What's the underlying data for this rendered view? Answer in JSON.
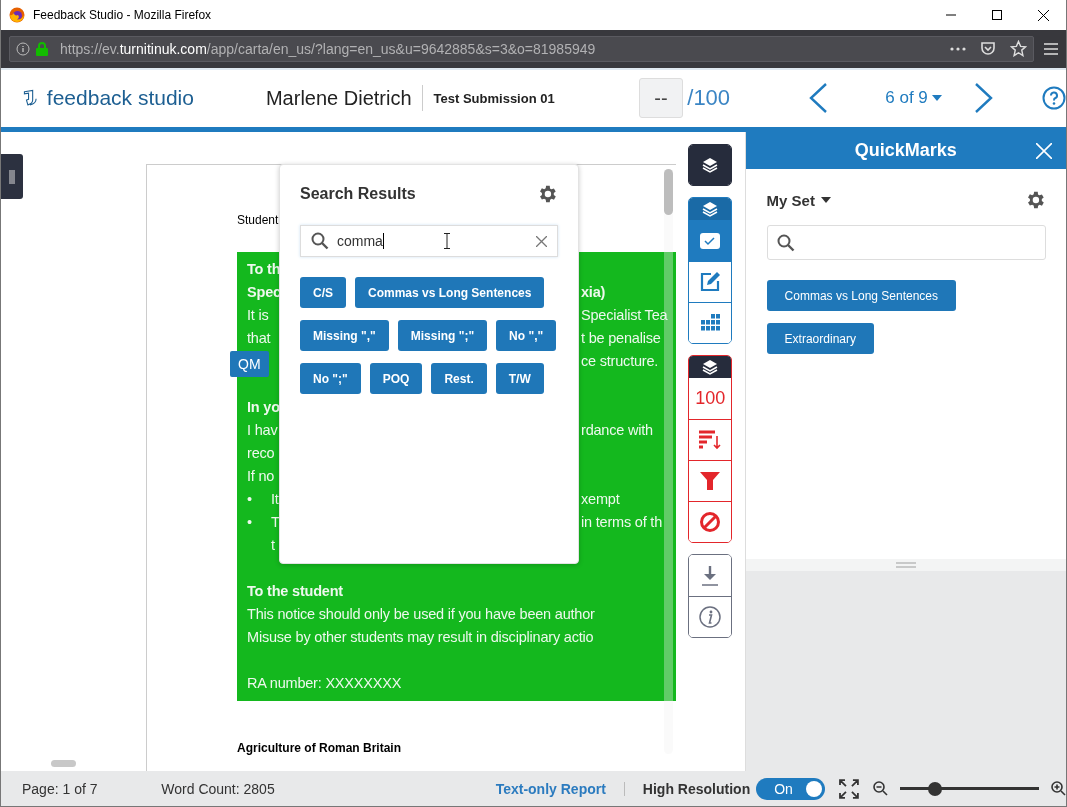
{
  "window": {
    "title": "Feedback Studio - Mozilla Firefox"
  },
  "browser": {
    "url": "https://ev.**turnitinuk.com**/app/carta/en_us/?lang=en_us&u=9642885&s=3&o=81985949"
  },
  "header": {
    "brand": "feedback studio",
    "student": "Marlene Dietrich",
    "assignment": "Test Submission 01",
    "score": "--",
    "score_max": "/100",
    "position": "6 of 9"
  },
  "document": {
    "student_label": "Student",
    "lines": [
      {
        "kind": "heading",
        "left": "To th"
      },
      {
        "kind": "heading",
        "left": "Spec",
        "right": "xia)"
      },
      {
        "kind": "text",
        "left": "It is",
        "right": "Specialist Tea"
      },
      {
        "kind": "text",
        "left": "that",
        "right": "t be penalise"
      },
      {
        "kind": "text",
        "right": "ce structure."
      },
      {
        "kind": "blank"
      },
      {
        "kind": "heading",
        "left": "In yo"
      },
      {
        "kind": "text",
        "left": "I hav",
        "right": "rdance with"
      },
      {
        "kind": "text",
        "left": "reco"
      },
      {
        "kind": "text",
        "left": "If no"
      },
      {
        "kind": "bullet",
        "bullet": "•",
        "left": "It",
        "right": "xempt"
      },
      {
        "kind": "bullet",
        "bullet": "•",
        "left": "T",
        "right": "in terms of th"
      },
      {
        "kind": "continuation",
        "left": "t"
      },
      {
        "kind": "blank"
      },
      {
        "kind": "heading",
        "left": "To the student"
      },
      {
        "kind": "text",
        "left": "This notice should only be used if you have been author"
      },
      {
        "kind": "text",
        "left": "Misuse by other students may result in disciplinary actio"
      },
      {
        "kind": "blank"
      },
      {
        "kind": "text",
        "left": "RA number: XXXXXXXX"
      }
    ],
    "title": "Agriculture of Roman Britain"
  },
  "qm_tag": "QM",
  "search_popup": {
    "title": "Search Results",
    "query": "comma",
    "results": [
      "C/S",
      "Commas vs Long Sentences",
      "Missing \",\"",
      "Missing \";\"",
      "No \",\"",
      "No \";\"",
      "POQ",
      "Rest.",
      "T/W"
    ]
  },
  "toolbar": {
    "groups": [
      {
        "color": "#262c3c",
        "buttons": [
          {
            "kind": "layers",
            "selected": true
          }
        ]
      },
      {
        "color": "#1f7bbf",
        "tab": {
          "color": "#1a6aa6"
        },
        "buttons": [
          {
            "kind": "check",
            "selected": true
          },
          {
            "kind": "edit",
            "selected": false
          },
          {
            "kind": "grid",
            "selected": false
          }
        ]
      },
      {
        "color": "#e3262b",
        "tab": {
          "color": "#262c3c"
        },
        "buttons": [
          {
            "kind": "score",
            "label": "100",
            "selected": false
          },
          {
            "kind": "sort",
            "selected": false
          },
          {
            "kind": "filter",
            "selected": false
          },
          {
            "kind": "ban",
            "selected": false
          }
        ]
      },
      {
        "color": "#6b7080",
        "buttons": [
          {
            "kind": "download",
            "selected": false
          },
          {
            "kind": "info",
            "selected": false
          }
        ]
      }
    ]
  },
  "quickmarks": {
    "title": "QuickMarks",
    "set": "My Set",
    "marks": [
      "Commas vs Long Sentences",
      "Extraordinary"
    ]
  },
  "status_bar": {
    "page": "Page: 1 of 7",
    "word_count": "Word Count: 2805",
    "report_link": "Text-only Report",
    "high_resolution": {
      "label": "High Resolution",
      "on": true,
      "value": "On"
    },
    "zoom": {
      "level": 0.25
    }
  }
}
